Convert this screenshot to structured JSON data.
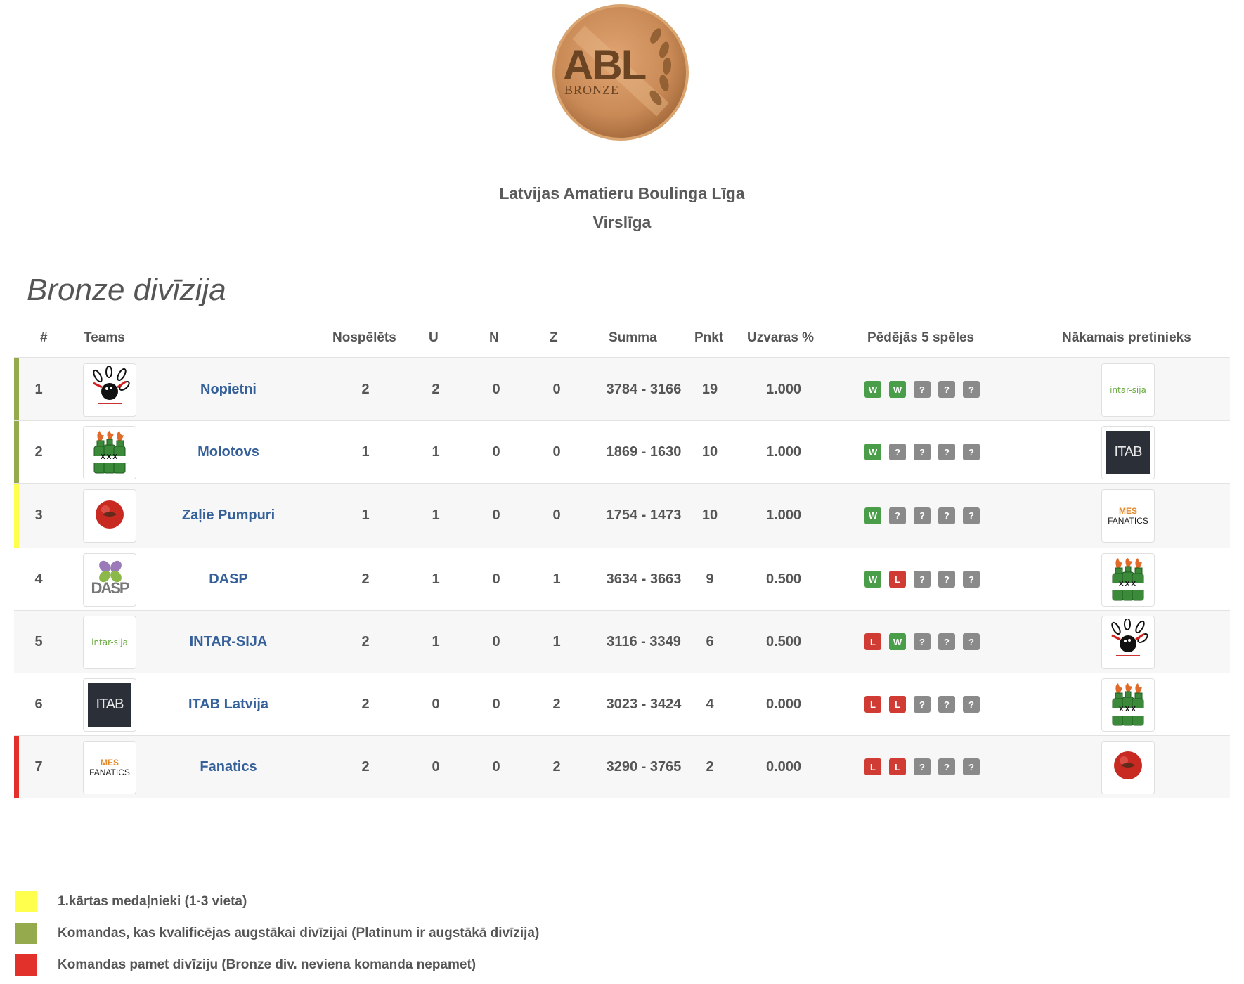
{
  "logo": {
    "main_text": "ABL",
    "sub_text": "BRONZE"
  },
  "header": {
    "league_name": "Latvijas Amatieru Boulinga Līga",
    "league_tier": "Virslīga"
  },
  "division_title": "Bronze divīzija",
  "columns": {
    "rank": "#",
    "team": "Teams",
    "played": "Nospēlēts",
    "won": "U",
    "drawn": "N",
    "lost": "Z",
    "total": "Summa",
    "points": "Pnkt",
    "win_pct": "Uzvaras %",
    "last5": "Pēdējās 5 spēles",
    "next": "Nākamais pretinieks"
  },
  "colors": {
    "yellow": "#ffff4d",
    "olive": "#94aa4c",
    "red": "#e2312a",
    "link": "#35609a",
    "win": "#4a9e4a",
    "loss": "#d03b34",
    "unknown": "#8a8a8a"
  },
  "rows": [
    {
      "rank": "1",
      "team": "Nopietni",
      "logo": "bowling-icon",
      "played": "2",
      "won": "2",
      "drawn": "0",
      "lost": "0",
      "total": "3784 - 3166",
      "points": "19",
      "win_pct": "1.000",
      "form": [
        "W",
        "W",
        "?",
        "?",
        "?"
      ],
      "next_logo": "intar-sija-logo",
      "bar": "olive"
    },
    {
      "rank": "2",
      "team": "Molotovs",
      "logo": "molotov-bottles-icon",
      "played": "1",
      "won": "1",
      "drawn": "0",
      "lost": "0",
      "total": "1869 - 1630",
      "points": "10",
      "win_pct": "1.000",
      "form": [
        "W",
        "?",
        "?",
        "?",
        "?"
      ],
      "next_logo": "itab-logo",
      "bar": "olive"
    },
    {
      "rank": "3",
      "team": "Zaļie Pumpuri",
      "logo": "red-ball-icon",
      "played": "1",
      "won": "1",
      "drawn": "0",
      "lost": "0",
      "total": "1754 - 1473",
      "points": "10",
      "win_pct": "1.000",
      "form": [
        "W",
        "?",
        "?",
        "?",
        "?"
      ],
      "next_logo": "fanatics-logo",
      "bar": "yellow"
    },
    {
      "rank": "4",
      "team": "DASP",
      "logo": "dasp-logo",
      "played": "2",
      "won": "1",
      "drawn": "0",
      "lost": "1",
      "total": "3634 - 3663",
      "points": "9",
      "win_pct": "0.500",
      "form": [
        "W",
        "L",
        "?",
        "?",
        "?"
      ],
      "next_logo": "molotov-bottles-icon",
      "bar": ""
    },
    {
      "rank": "5",
      "team": "INTAR-SIJA",
      "logo": "intar-sija-logo",
      "played": "2",
      "won": "1",
      "drawn": "0",
      "lost": "1",
      "total": "3116 - 3349",
      "points": "6",
      "win_pct": "0.500",
      "form": [
        "L",
        "W",
        "?",
        "?",
        "?"
      ],
      "next_logo": "bowling-icon",
      "bar": ""
    },
    {
      "rank": "6",
      "team": "ITAB Latvija",
      "logo": "itab-logo",
      "played": "2",
      "won": "0",
      "drawn": "0",
      "lost": "2",
      "total": "3023 - 3424",
      "points": "4",
      "win_pct": "0.000",
      "form": [
        "L",
        "L",
        "?",
        "?",
        "?"
      ],
      "next_logo": "molotov-bottles-icon",
      "bar": ""
    },
    {
      "rank": "7",
      "team": "Fanatics",
      "logo": "fanatics-logo",
      "played": "2",
      "won": "0",
      "drawn": "0",
      "lost": "2",
      "total": "3290 - 3765",
      "points": "2",
      "win_pct": "0.000",
      "form": [
        "L",
        "L",
        "?",
        "?",
        "?"
      ],
      "next_logo": "red-ball-icon",
      "bar": "red"
    }
  ],
  "logo_text": {
    "intar": "intar-sija",
    "itab": "ITAB",
    "dasp": "DASP",
    "fanatics_top": "MES",
    "fanatics_main": "FANATICS",
    "molotov": "XXX"
  },
  "legend": [
    {
      "color": "yellow",
      "text": "1.kārtas medaļnieki (1-3 vieta)"
    },
    {
      "color": "olive",
      "text": "Komandas, kas kvalificējas augstākai divīzijai (Platinum ir augstākā divīzija)"
    },
    {
      "color": "red",
      "text": "Komandas pamet divīziju (Bronze div. neviena komanda nepamet)"
    }
  ]
}
